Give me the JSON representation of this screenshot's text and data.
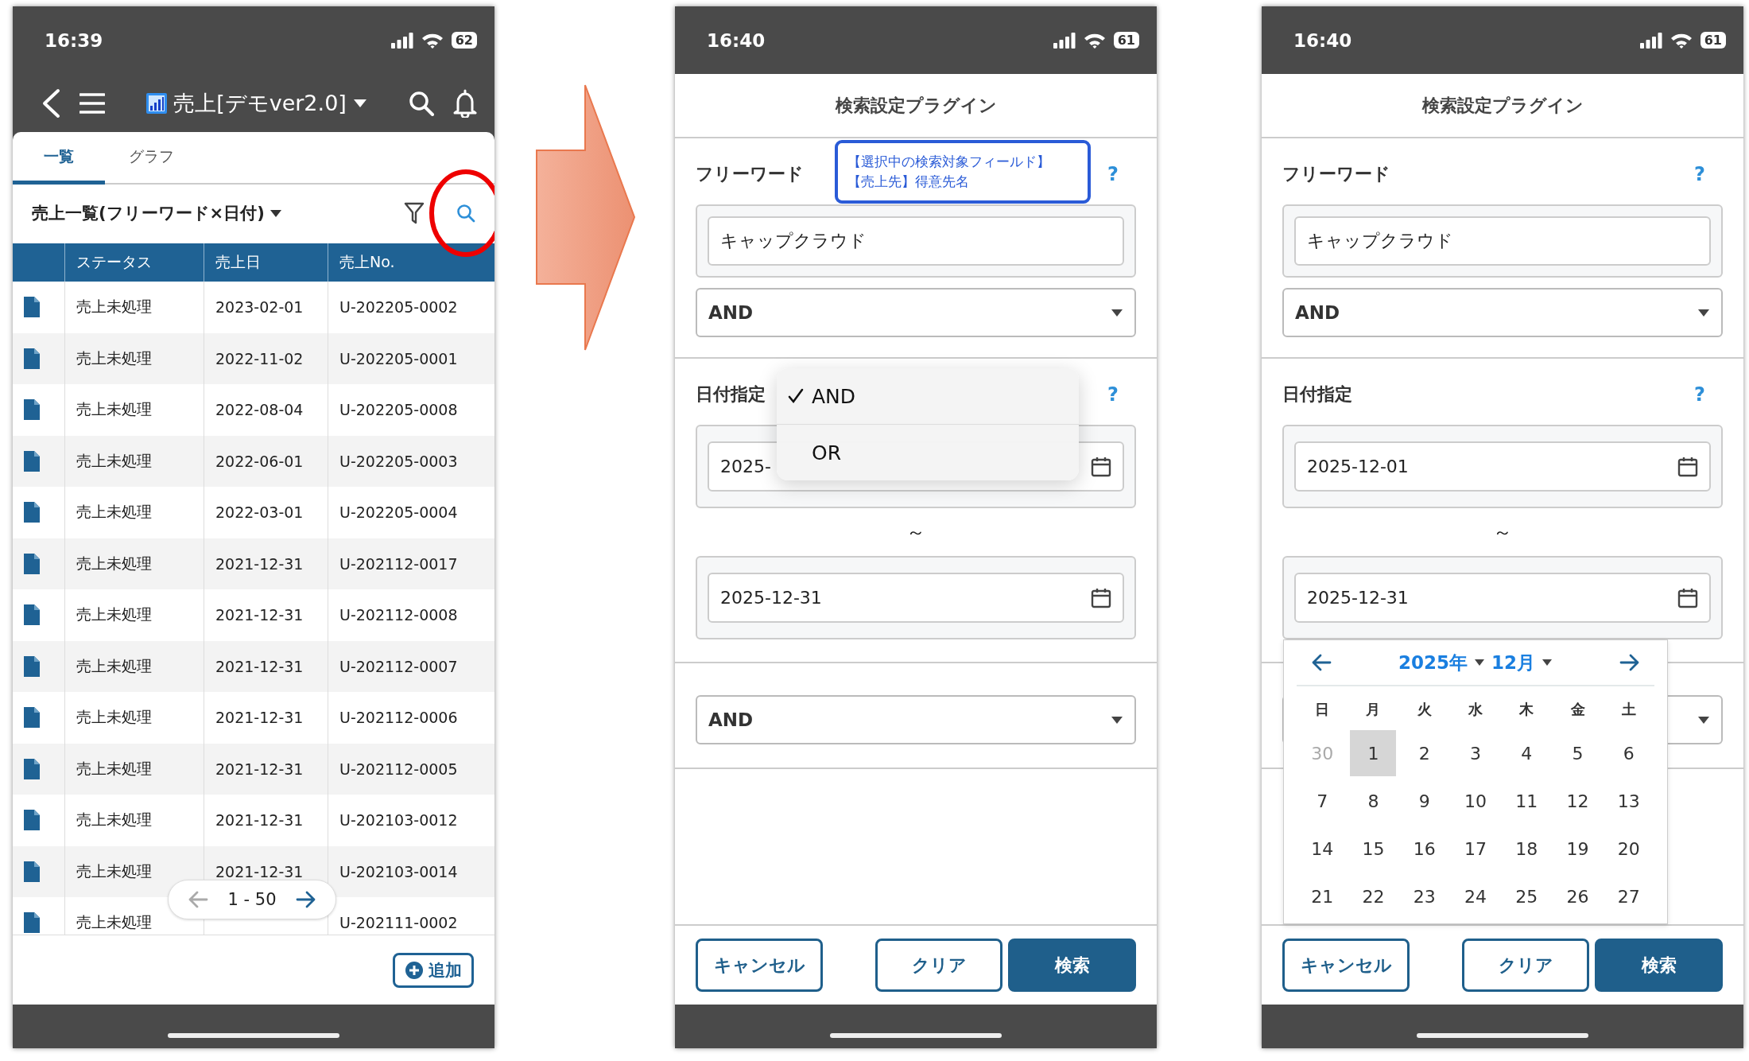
{
  "screens": [
    {
      "kind": "list",
      "status_bar": {
        "time": "16:39",
        "battery": "62"
      },
      "header": {
        "title": "売上[デモver2.0]"
      },
      "tabs": [
        {
          "label": "一覧",
          "selected": true
        },
        {
          "label": "グラフ",
          "selected": false
        }
      ],
      "list_title": "売上一覧(フリーワード×日付)",
      "search_highlighted": true,
      "table": {
        "columns": [
          "ステータス",
          "売上日",
          "売上No."
        ],
        "rows": [
          {
            "status": "売上未処理",
            "date": "2023-02-01",
            "number": "U-202205-0002"
          },
          {
            "status": "売上未処理",
            "date": "2022-11-02",
            "number": "U-202205-0001"
          },
          {
            "status": "売上未処理",
            "date": "2022-08-04",
            "number": "U-202205-0008"
          },
          {
            "status": "売上未処理",
            "date": "2022-06-01",
            "number": "U-202205-0003"
          },
          {
            "status": "売上未処理",
            "date": "2022-03-01",
            "number": "U-202205-0004"
          },
          {
            "status": "売上未処理",
            "date": "2021-12-31",
            "number": "U-202112-0017"
          },
          {
            "status": "売上未処理",
            "date": "2021-12-31",
            "number": "U-202112-0008"
          },
          {
            "status": "売上未処理",
            "date": "2021-12-31",
            "number": "U-202112-0007"
          },
          {
            "status": "売上未処理",
            "date": "2021-12-31",
            "number": "U-202112-0006"
          },
          {
            "status": "売上未処理",
            "date": "2021-12-31",
            "number": "U-202112-0005"
          },
          {
            "status": "売上未処理",
            "date": "2021-12-31",
            "number": "U-202103-0012"
          },
          {
            "status": "売上未処理",
            "date": "2021-12-31",
            "number": "U-202103-0014"
          },
          {
            "status": "売上未処理",
            "number": "U-202111-0002"
          }
        ]
      },
      "pager": {
        "range": "1 - 50",
        "prev_disabled": true
      },
      "add_button": "追加"
    },
    {
      "kind": "search",
      "status_bar": {
        "time": "16:40",
        "battery": "61"
      },
      "title": "検索設定プラグイン",
      "sections": [
        {
          "kind": "freeword",
          "label": "フリーワード",
          "help": "?",
          "value": "キャップクラウド",
          "operator": "AND"
        },
        {
          "kind": "date",
          "label": "日付指定",
          "help": "?",
          "from": "2025-",
          "separator": "～",
          "to": "2025-12-31"
        },
        {
          "kind": "operator",
          "operator": "AND"
        }
      ],
      "tooltip": [
        "【選択中の検索対象フィールド】",
        "【売上先】得意先名"
      ],
      "dropdown": [
        {
          "label": "AND",
          "selected": true
        },
        {
          "label": "OR",
          "selected": false
        }
      ],
      "buttons": [
        {
          "label": "キャンセル",
          "kind": "outline"
        },
        {
          "label": "クリア",
          "kind": "outline"
        },
        {
          "label": "検索",
          "kind": "primary"
        }
      ]
    },
    {
      "kind": "search",
      "status_bar": {
        "time": "16:40",
        "battery": "61"
      },
      "title": "検索設定プラグイン",
      "sections": [
        {
          "kind": "freeword",
          "label": "フリーワード",
          "help": "?",
          "value": "キャップクラウド",
          "operator": "AND"
        },
        {
          "kind": "date",
          "label": "日付指定",
          "help": "?",
          "from": "2025-12-01",
          "separator": "～",
          "to": "2025-12-31"
        },
        {
          "kind": "operator"
        }
      ],
      "calendar": {
        "year": "2025年",
        "month": "12月",
        "weekdays": [
          "日",
          "月",
          "火",
          "水",
          "木",
          "金",
          "土"
        ],
        "weeks": [
          [
            {
              "day": "30",
              "muted": true,
              "selected": false
            },
            {
              "day": "1",
              "muted": false,
              "selected": true
            },
            {
              "day": "2",
              "muted": false,
              "selected": false
            },
            {
              "day": "3",
              "muted": false,
              "selected": false
            },
            {
              "day": "4",
              "muted": false,
              "selected": false
            },
            {
              "day": "5",
              "muted": false,
              "selected": false
            },
            {
              "day": "6",
              "muted": false,
              "selected": false
            }
          ],
          [
            {
              "day": "7",
              "muted": false,
              "selected": false
            },
            {
              "day": "8",
              "muted": false,
              "selected": false
            },
            {
              "day": "9",
              "muted": false,
              "selected": false
            },
            {
              "day": "10",
              "muted": false,
              "selected": false
            },
            {
              "day": "11",
              "muted": false,
              "selected": false
            },
            {
              "day": "12",
              "muted": false,
              "selected": false
            },
            {
              "day": "13",
              "muted": false,
              "selected": false
            }
          ],
          [
            {
              "day": "14",
              "muted": false,
              "selected": false
            },
            {
              "day": "15",
              "muted": false,
              "selected": false
            },
            {
              "day": "16",
              "muted": false,
              "selected": false
            },
            {
              "day": "17",
              "muted": false,
              "selected": false
            },
            {
              "day": "18",
              "muted": false,
              "selected": false
            },
            {
              "day": "19",
              "muted": false,
              "selected": false
            },
            {
              "day": "20",
              "muted": false,
              "selected": false
            }
          ],
          [
            {
              "day": "21",
              "muted": false,
              "selected": false
            },
            {
              "day": "22",
              "muted": false,
              "selected": false
            },
            {
              "day": "23",
              "muted": false,
              "selected": false
            },
            {
              "day": "24",
              "muted": false,
              "selected": false
            },
            {
              "day": "25",
              "muted": false,
              "selected": false
            },
            {
              "day": "26",
              "muted": false,
              "selected": false
            },
            {
              "day": "27",
              "muted": false,
              "selected": false
            }
          ]
        ]
      },
      "buttons": [
        {
          "label": "キャンセル",
          "kind": "outline"
        },
        {
          "label": "クリア",
          "kind": "outline"
        },
        {
          "label": "検索",
          "kind": "primary"
        }
      ]
    }
  ]
}
